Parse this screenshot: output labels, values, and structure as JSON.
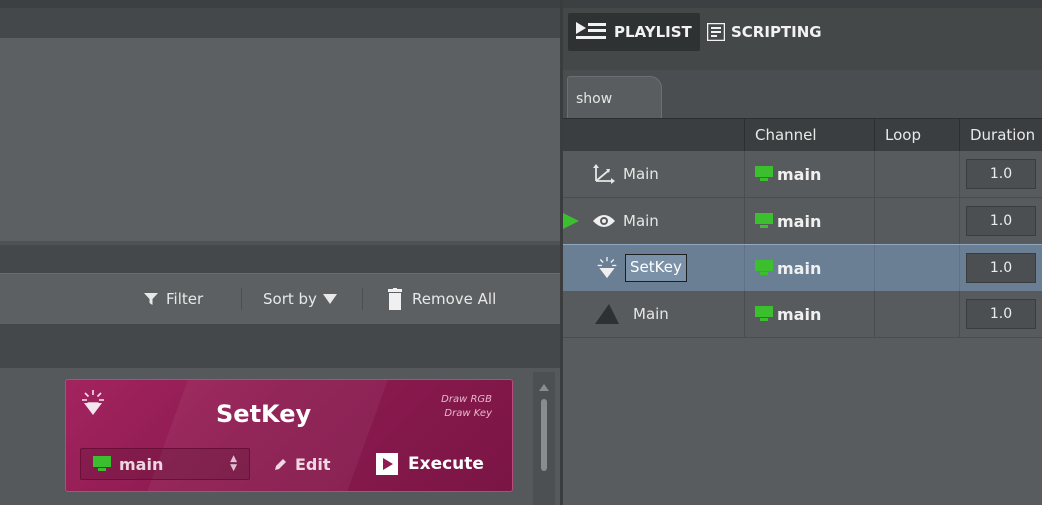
{
  "left_toolbar": {
    "filter_label": "Filter",
    "sort_label": "Sort by",
    "remove_all_label": "Remove All"
  },
  "card": {
    "title": "SetKey",
    "sub_line1": "Draw RGB",
    "sub_line2": "Draw Key",
    "channel_value": "main",
    "edit_label": "Edit",
    "execute_label": "Execute",
    "color": "#8e1b51"
  },
  "right_tabs": {
    "playlist_label": "PLAYLIST",
    "scripting_label": "SCRIPTING"
  },
  "doc_tab": {
    "label": "show"
  },
  "grid": {
    "headers": [
      "",
      "Channel",
      "Loop",
      "Duration"
    ],
    "rows": [
      {
        "icon": "axis-transform-icon",
        "name": "Main",
        "channel": "main",
        "loop": "",
        "duration": "1.0",
        "playing": false,
        "selected": false
      },
      {
        "icon": "eye-icon",
        "name": "Main",
        "channel": "main",
        "loop": "",
        "duration": "1.0",
        "playing": true,
        "selected": false
      },
      {
        "icon": "setkey-icon",
        "name": "SetKey",
        "channel": "main",
        "loop": "",
        "duration": "1.0",
        "playing": false,
        "selected": true
      },
      {
        "icon": "triangle-shape-icon",
        "name": "Main",
        "channel": "main",
        "loop": "",
        "duration": "1.0",
        "playing": false,
        "selected": false
      }
    ]
  },
  "colors": {
    "channel_green": "#3bbf2e",
    "selection": "#6b7f94",
    "card_magenta": "#8e1b51"
  }
}
